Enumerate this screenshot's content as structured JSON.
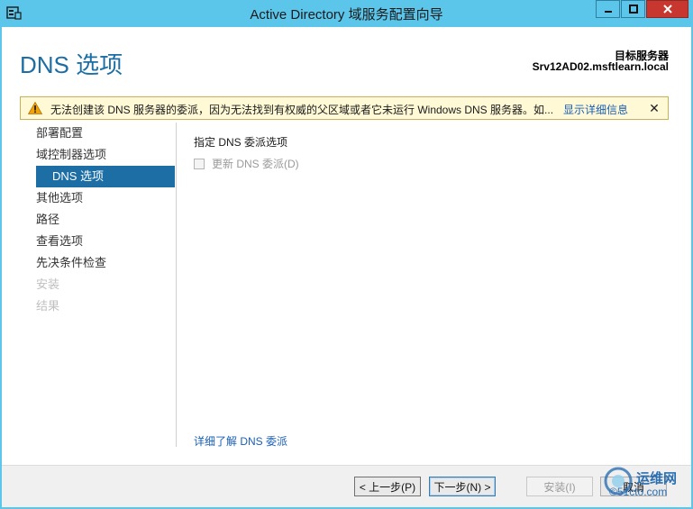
{
  "window": {
    "title": "Active Directory 域服务配置向导"
  },
  "header": {
    "page_title": "DNS 选项",
    "target_label": "目标服务器",
    "target_name": "Srv12AD02.msftlearn.local"
  },
  "warning": {
    "text": "无法创建该 DNS 服务器的委派，因为无法找到有权威的父区域或者它未运行 Windows DNS 服务器。如...",
    "link": "显示详细信息",
    "close": "✕"
  },
  "nav": {
    "items": [
      {
        "label": "部署配置"
      },
      {
        "label": "域控制器选项"
      },
      {
        "label": "DNS 选项"
      },
      {
        "label": "其他选项"
      },
      {
        "label": "路径"
      },
      {
        "label": "查看选项"
      },
      {
        "label": "先决条件检查"
      },
      {
        "label": "安装"
      },
      {
        "label": "结果"
      }
    ]
  },
  "main": {
    "section_title": "指定 DNS 委派选项",
    "checkbox_label": "更新 DNS 委派(D)",
    "more_link": "详细了解 DNS 委派"
  },
  "footer": {
    "prev_label": "< 上一步(P)",
    "next_label": "下一步(N) >",
    "install_label": "安装(I)",
    "cancel_label": "取消"
  },
  "watermark": {
    "text1": "运维网",
    "text2": "©51cto.com"
  }
}
